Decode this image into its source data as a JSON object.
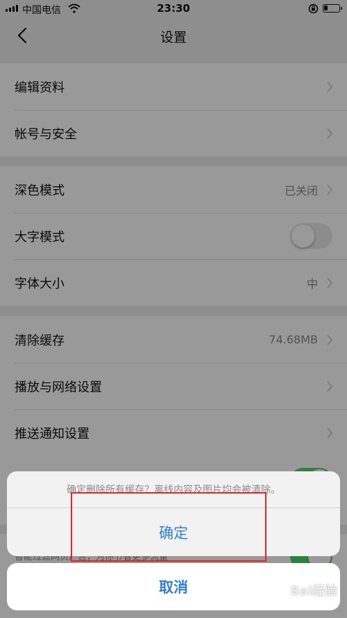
{
  "status_bar": {
    "carrier": "中国电信",
    "time": "23:30"
  },
  "nav": {
    "title": "设置"
  },
  "groups": [
    {
      "rows": [
        {
          "label": "编辑资料"
        },
        {
          "label": "帐号与安全"
        }
      ]
    },
    {
      "rows": [
        {
          "label": "深色模式",
          "value": "已关闭"
        },
        {
          "label": "大字模式",
          "toggle": false
        },
        {
          "label": "字体大小",
          "value": "中"
        }
      ]
    },
    {
      "rows": [
        {
          "label": "清除缓存",
          "value": "74.68MB"
        },
        {
          "label": "播放与网络设置"
        },
        {
          "label": "推送通知设置"
        }
      ]
    }
  ],
  "hint": "智能过滤网页广告，为你节省更多流量",
  "action_sheet": {
    "message": "确定删除所有缓存？离线内容及图片均会被清除。",
    "confirm_label": "确定",
    "cancel_label": "取消"
  },
  "watermark": "Bai经验",
  "colors": {
    "accent_blue": "#2f7fd8",
    "toggle_on": "#4cd964",
    "highlight_red": "#e62222"
  }
}
